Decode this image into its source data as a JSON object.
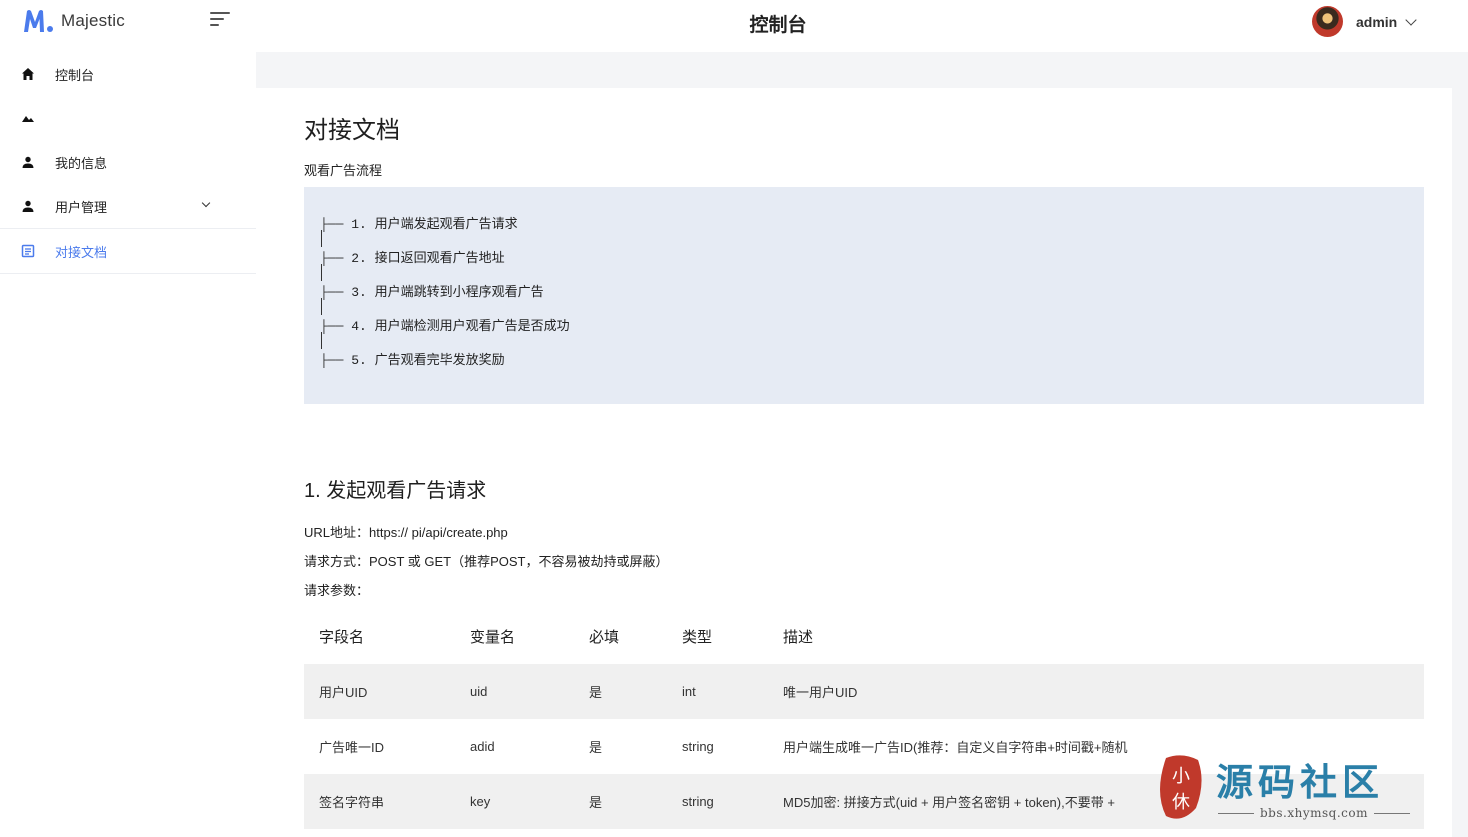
{
  "brand": {
    "name": "Majestic"
  },
  "header": {
    "title": "控制台",
    "user": "admin"
  },
  "sidebar": {
    "items": [
      {
        "label": "控制台",
        "icon": "home-icon"
      },
      {
        "label": "",
        "icon": "landscape-icon"
      },
      {
        "label": "我的信息",
        "icon": "person-icon"
      },
      {
        "label": "用户管理",
        "icon": "person-icon"
      },
      {
        "label": "对接文档",
        "icon": "document-icon"
      }
    ]
  },
  "doc": {
    "title": "对接文档",
    "flow_label": "观看广告流程",
    "flow": [
      "1. 用户端发起观看广告请求",
      "2. 接口返回观看广告地址",
      "3. 用户端跳转到小程序观看广告",
      "4. 用户端检测用户观看广告是否成功",
      "5. 广告观看完毕发放奖励"
    ],
    "section1": {
      "title": "1. 发起观看广告请求",
      "url": "URL地址：https://           pi/api/create.php",
      "method": "请求方式：POST 或 GET（推荐POST，不容易被劫持或屏蔽）",
      "params_label": "请求参数：",
      "table": {
        "headers": [
          "字段名",
          "变量名",
          "必填",
          "类型",
          "描述"
        ],
        "rows": [
          [
            "用户UID",
            "uid",
            "是",
            "int",
            "唯一用户UID"
          ],
          [
            "广告唯一ID",
            "adid",
            "是",
            "string",
            "用户端生成唯一广告ID(推荐：自定义自字符串+时间戳+随机"
          ],
          [
            "签名字符串",
            "key",
            "是",
            "string",
            "MD5加密: 拼接方式(uid + 用户签名密钥 + token),不要带 +"
          ]
        ]
      }
    }
  },
  "watermark": {
    "text": "源码社区",
    "seal": "小休",
    "url": "bbs.xhymsq.com"
  },
  "colors": {
    "accent": "#4b7bec",
    "flow_bg": "#e6ebf4",
    "watermark": "#2a7fa8"
  }
}
